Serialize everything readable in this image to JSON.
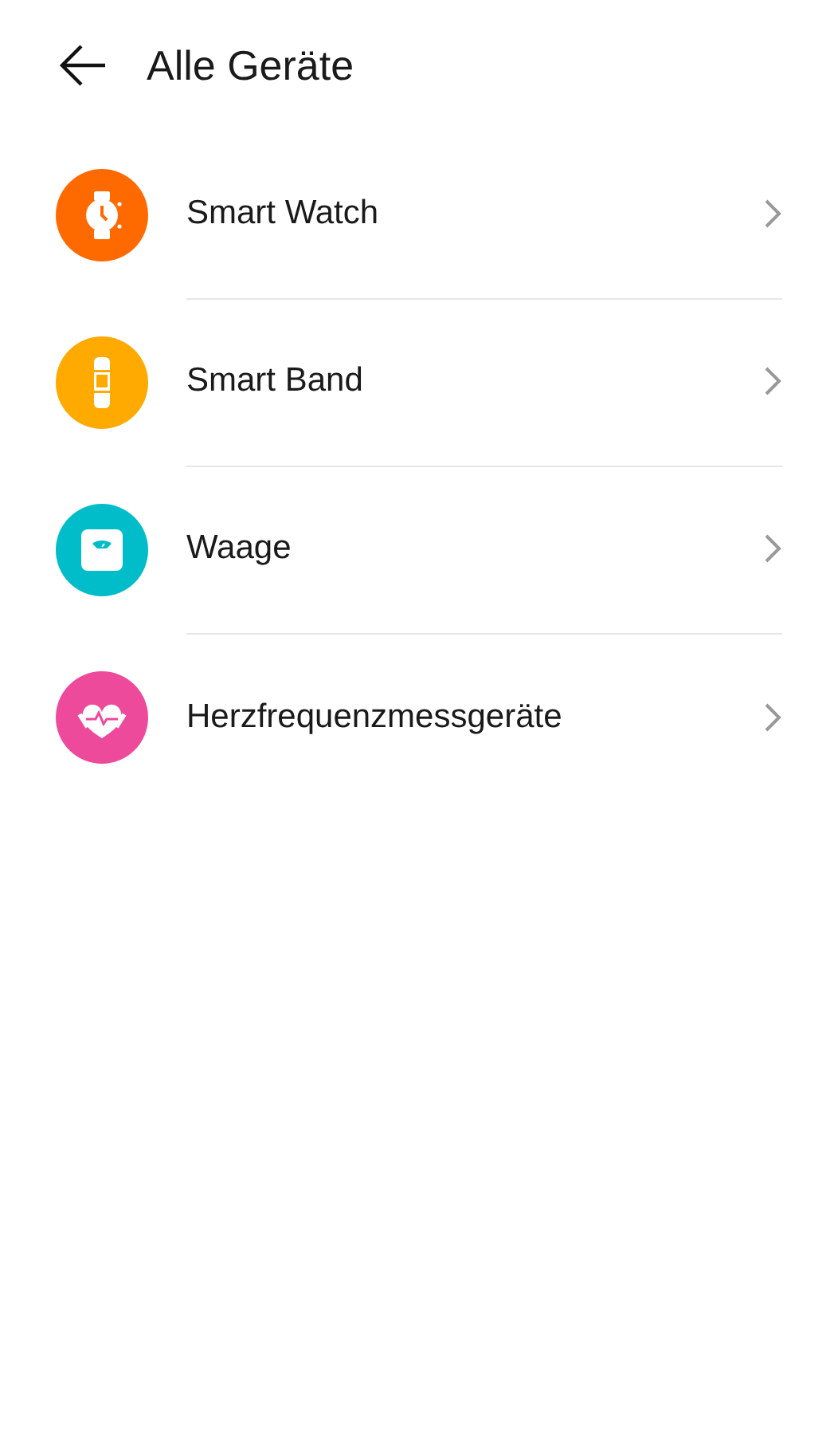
{
  "header": {
    "title": "Alle Geräte"
  },
  "devices": [
    {
      "name": "Smart Watch",
      "kind": "watch",
      "color": "#ff6a00"
    },
    {
      "name": "Smart Band",
      "kind": "band",
      "color": "#ffaa00"
    },
    {
      "name": "Waage",
      "kind": "scale",
      "color": "#00bdc9"
    },
    {
      "name": "Herzfrequenzmessgeräte",
      "kind": "heart",
      "color": "#ee4a9c"
    }
  ]
}
